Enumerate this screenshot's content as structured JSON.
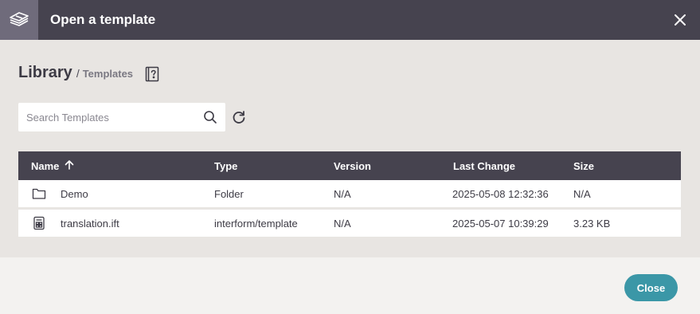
{
  "dialog": {
    "title": "Open a template"
  },
  "breadcrumb": {
    "root": "Library",
    "separator": "/",
    "current": "Templates"
  },
  "search": {
    "placeholder": "Search Templates",
    "value": ""
  },
  "table": {
    "columns": [
      "Name",
      "Type",
      "Version",
      "Last Change",
      "Size"
    ],
    "sort": {
      "column": "Name",
      "direction": "ascending"
    },
    "rows": [
      {
        "icon": "folder-icon",
        "name": "Demo",
        "type": "Folder",
        "version": "N/A",
        "last_change": "2025-05-08 12:32:36",
        "size": "N/A"
      },
      {
        "icon": "template-file-icon",
        "name": "translation.ift",
        "type": "interform/template",
        "version": "N/A",
        "last_change": "2025-05-07 10:39:29",
        "size": "3.23 KB"
      }
    ]
  },
  "footer": {
    "close_label": "Close"
  },
  "colors": {
    "header": "#46434f",
    "accent": "#3b97a7",
    "content_bg": "#e8e5e2"
  }
}
